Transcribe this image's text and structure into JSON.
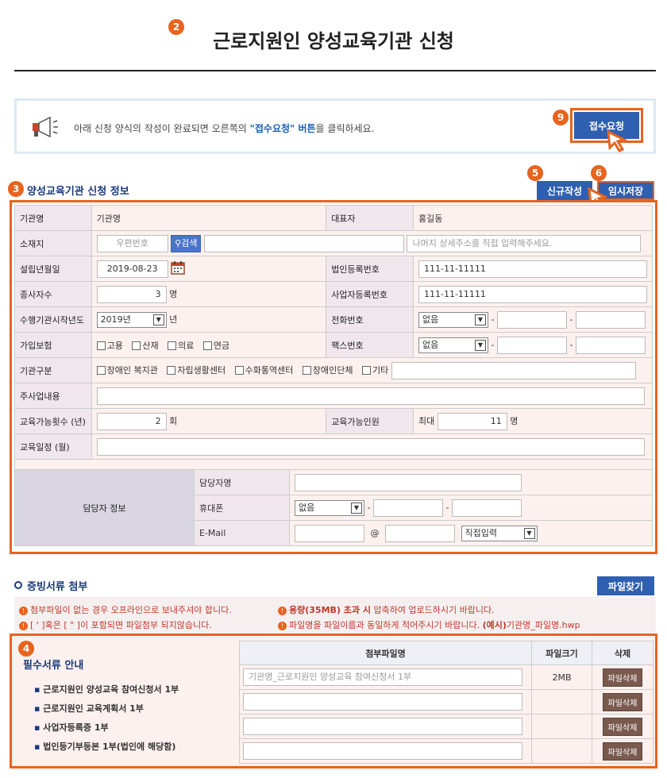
{
  "header": {
    "title": "근로지원인 양성교육기관 신청"
  },
  "badges": {
    "b2": "2",
    "b3": "3",
    "b4": "4",
    "b5": "5",
    "b6": "6",
    "b9": "9"
  },
  "notice": {
    "prefix": "아래 신청 양식의 작성이 완료되면 오른쪽의 ",
    "highlight": "\"접수요청\" 버튼",
    "suffix": "을 클릭하세요.",
    "submit_label": "접수요청"
  },
  "section1": {
    "title": "양성교육기관 신청 정보",
    "new_label": "신규작성",
    "temp_save_label": "임시저장"
  },
  "form": {
    "org_name_label": "기관명",
    "org_name_value": "기관명",
    "rep_label": "대표자",
    "rep_value": "홍길동",
    "addr_label": "소재지",
    "zip_placeholder": "우편번호",
    "search_label": "검색",
    "addr_detail_placeholder": "나머지 상세주소를 직접 입력해주세요.",
    "est_label": "설립년월일",
    "est_value": "2019-08-23",
    "corp_no_label": "법인등록번호",
    "corp_no_value": "111-11-11111",
    "staff_label": "종사자수",
    "staff_value": "3",
    "staff_unit": "명",
    "biz_no_label": "사업자등록번호",
    "biz_no_value": "111-11-11111",
    "start_year_label": "수행기관시작년도",
    "start_year_value": "2019년",
    "start_year_unit": "년",
    "phone_label": "전화번호",
    "phone_select": "없음",
    "insurance_label": "가입보험",
    "insurance": [
      "고용",
      "산재",
      "의료",
      "연금"
    ],
    "fax_label": "팩스번호",
    "fax_select": "없음",
    "org_type_label": "기관구분",
    "org_types": [
      "장애인 복지관",
      "자립생활센터",
      "수화통역센터",
      "장애인단체",
      "기타"
    ],
    "main_biz_label": "주사업내용",
    "edu_count_label": "교육가능횟수 (년)",
    "edu_count_value": "2",
    "edu_count_unit": "회",
    "edu_people_label": "교육가능인원",
    "edu_people_prefix": "최대",
    "edu_people_value": "11",
    "edu_people_unit": "명",
    "edu_schedule_label": "교육일정 (월)",
    "contact_label": "담당자 정보",
    "contact_name_label": "담당자명",
    "mobile_label": "휴대폰",
    "mobile_select": "없음",
    "email_label": "E-Mail",
    "email_at": "@",
    "email_domain_select": "직접입력",
    "dash": "-"
  },
  "section2": {
    "title": "증빙서류 첨부",
    "find_file_label": "파일찾기",
    "notes_left": [
      "첨부파일이 없는 경우 오프라인으로 보내주셔야 합니다.",
      "[ ' ]혹은 [ \" ]이 포함되면 파일첨부 되지않습니다."
    ],
    "note_right1_bold": "용량(35MB) 초과 시",
    "note_right1_rest": " 압축하여 업로드하시기 바랍니다.",
    "note_right2_pre": "파일명을 파일이름과 동일하게 적어주시기 바랍니다. ",
    "note_right2_bold": "(예시)",
    "note_right2_post": "기관명_파일명.hwp"
  },
  "docs": {
    "guide_title": "필수서류 안내",
    "items": [
      "근로지원인 양성교육 참여신청서 1부",
      "근로지원인 교육계획서 1부",
      "사업자등록증 1부",
      "법인등기부등본 1부(법인에 해당함)"
    ],
    "col_file": "첨부파일명",
    "col_size": "파일크기",
    "col_delete": "삭제",
    "row1_file": "기관명_근로지원인 양성교육 참여신청서 1부",
    "row1_size": "2MB",
    "delete_label": "파일삭제"
  }
}
